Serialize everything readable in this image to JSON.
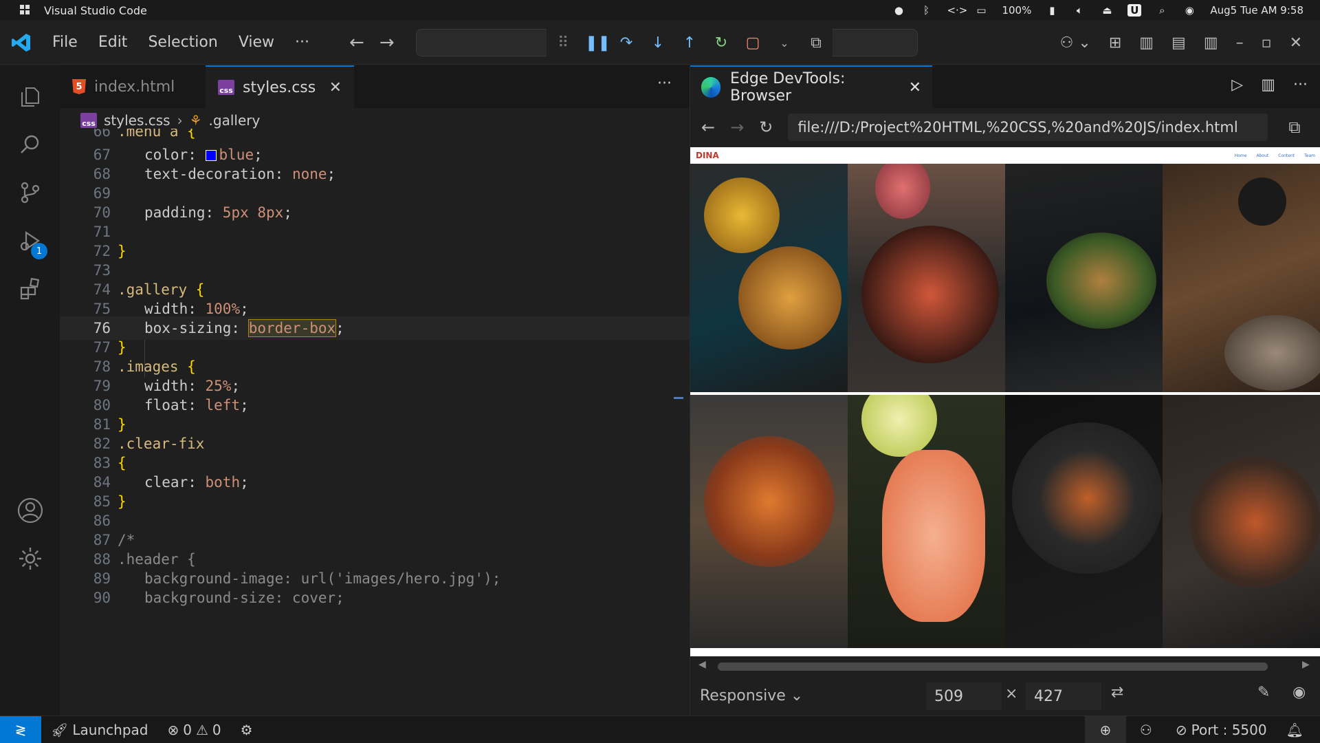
{
  "system_bar": {
    "app_name": "Visual Studio Code",
    "battery": "100%",
    "datetime": "Aug5 Tue AM 9:58"
  },
  "menu": {
    "items": [
      "File",
      "Edit",
      "Selection",
      "View",
      "···"
    ]
  },
  "editor": {
    "tabs": [
      {
        "label": "index.html",
        "icon": "html5-icon",
        "active": false
      },
      {
        "label": "styles.css",
        "icon": "css-icon",
        "active": true
      }
    ],
    "more": "···",
    "breadcrumb": {
      "file": "styles.css",
      "symbol": ".gallery"
    },
    "lines": [
      {
        "n": "66",
        "text": ".menu a {"
      },
      {
        "n": "67",
        "text": "color: blue;"
      },
      {
        "n": "68",
        "text": "text-decoration: none;"
      },
      {
        "n": "69",
        "text": ""
      },
      {
        "n": "70",
        "text": "padding: 5px 8px;"
      },
      {
        "n": "71",
        "text": ""
      },
      {
        "n": "72",
        "text": "}"
      },
      {
        "n": "73",
        "text": ""
      },
      {
        "n": "74",
        "text": ".gallery {"
      },
      {
        "n": "75",
        "text": "width: 100%;"
      },
      {
        "n": "76",
        "text": "box-sizing: border-box;"
      },
      {
        "n": "77",
        "text": "}"
      },
      {
        "n": "78",
        "text": ".images {"
      },
      {
        "n": "79",
        "text": "width: 25%;"
      },
      {
        "n": "80",
        "text": "float: left;"
      },
      {
        "n": "81",
        "text": "}"
      },
      {
        "n": "82",
        "text": ".clear-fix"
      },
      {
        "n": "83",
        "text": "{"
      },
      {
        "n": "84",
        "text": "clear: both;"
      },
      {
        "n": "85",
        "text": "}"
      },
      {
        "n": "86",
        "text": ""
      },
      {
        "n": "87",
        "text": "/*"
      },
      {
        "n": "88",
        "text": ".header {"
      },
      {
        "n": "89",
        "text": "background-image: url('images/hero.jpg');"
      },
      {
        "n": "90",
        "text": "background-size: cover;"
      }
    ]
  },
  "browser": {
    "tab_title": "Edge DevTools: Browser",
    "url": "file:///D:/Project%20HTML,%20CSS,%20and%20JS/index.html",
    "site": {
      "logo": "DINA",
      "menu": [
        "Home",
        "About",
        "Content",
        "Team"
      ]
    },
    "device": "Responsive",
    "width": "509",
    "height": "427",
    "times": "×"
  },
  "activity": {
    "run_badge": "1"
  },
  "status": {
    "launchpad": "Launchpad",
    "errors": "0",
    "warnings": "0",
    "port": "Port : 5500"
  }
}
